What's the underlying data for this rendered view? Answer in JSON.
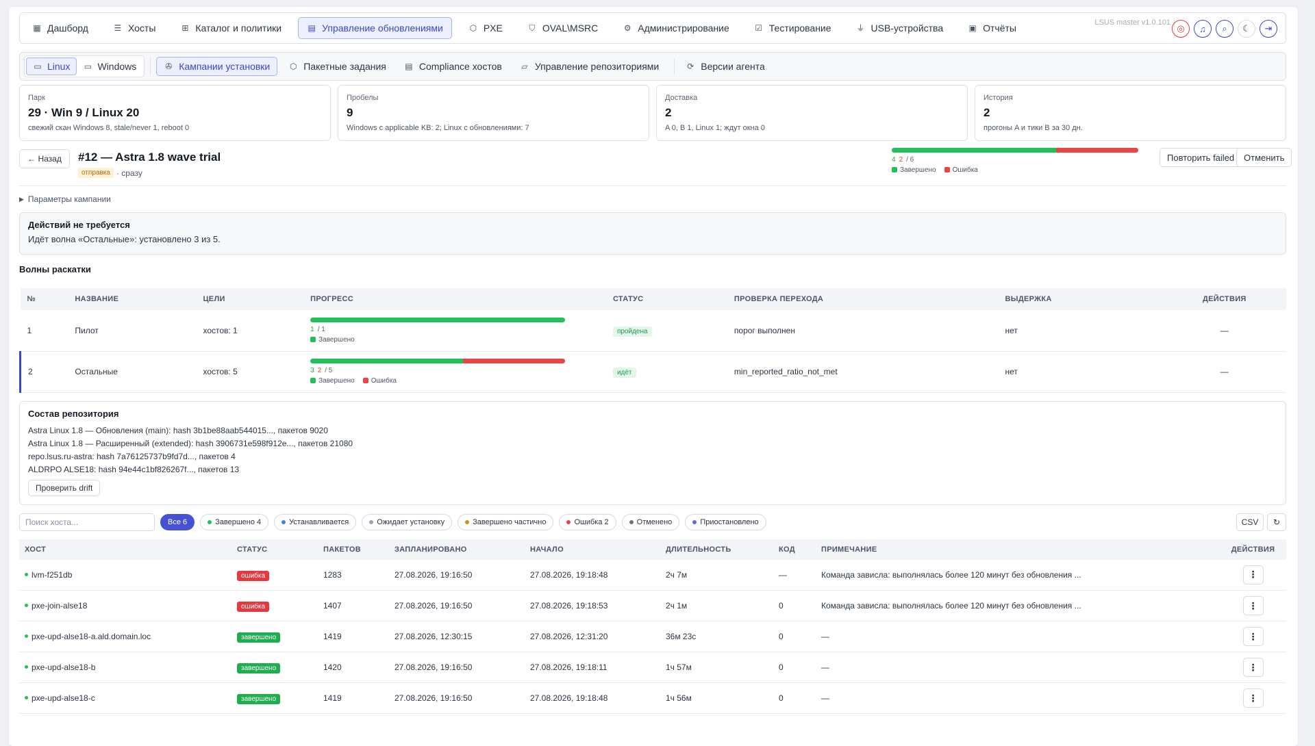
{
  "nav": {
    "items": [
      {
        "label": "Дашборд",
        "icon": "dashboard-icon",
        "glyph": "▦"
      },
      {
        "label": "Хосты",
        "icon": "server-icon",
        "glyph": "☰"
      },
      {
        "label": "Каталог и политики",
        "icon": "hierarchy-icon",
        "glyph": "⊞"
      },
      {
        "label": "Управление обновлениями",
        "icon": "download-file-icon",
        "glyph": "▤",
        "active": true
      },
      {
        "label": "PXE",
        "icon": "cube-icon",
        "glyph": "⬡"
      },
      {
        "label": "OVAL\\MSRC",
        "icon": "shield-check-icon",
        "glyph": "⛉"
      },
      {
        "label": "Администрирование",
        "icon": "user-gear-icon",
        "glyph": "⚙"
      },
      {
        "label": "Тестирование",
        "icon": "checklist-icon",
        "glyph": "☑"
      },
      {
        "label": "USB-устройства",
        "icon": "usb-icon",
        "glyph": "⏚"
      },
      {
        "label": "Отчёты",
        "icon": "report-icon",
        "glyph": "▣"
      }
    ],
    "version": "LSUS master v1.0.101",
    "icons": [
      "lifebuoy-icon",
      "bell-icon",
      "search-zoom-icon",
      "moon-icon",
      "logout-icon"
    ]
  },
  "subnav": {
    "os": [
      {
        "label": "Linux",
        "icon": "terminal-icon",
        "glyph": "▭",
        "active": true
      },
      {
        "label": "Windows",
        "icon": "monitor-icon",
        "glyph": "▭"
      }
    ],
    "items": [
      {
        "label": "Кампании установки",
        "icon": "megaphone-icon",
        "glyph": "✇",
        "active": true
      },
      {
        "label": "Пакетные задания",
        "icon": "package-icon",
        "glyph": "⬡"
      },
      {
        "label": "Compliance хостов",
        "icon": "list-check-icon",
        "glyph": "▤"
      },
      {
        "label": "Управление репозиториями",
        "icon": "folder-icon",
        "glyph": "▱"
      }
    ],
    "agent": {
      "label": "Версии агента",
      "icon": "gear-refresh-icon",
      "glyph": "⟳"
    }
  },
  "cards": [
    {
      "label": "Парк",
      "value": "29 · Win 9 / Linux 20",
      "sub": "свежий скан Windows 8, stale/never 1, reboot 0"
    },
    {
      "label": "Пробелы",
      "value": "9",
      "sub": "Windows с applicable KB: 2; Linux с обновлениями: 7"
    },
    {
      "label": "Доставка",
      "value": "2",
      "sub": "A 0, B 1, Linux 1; ждут окна 0"
    },
    {
      "label": "История",
      "value": "2",
      "sub": "прогоны A и тики B за 30 дн."
    }
  ],
  "campaign": {
    "back": "← Назад",
    "title": "#12 — Astra 1.8 wave trial",
    "badge": "отправка",
    "timing": "· сразу",
    "progress": {
      "done": 4,
      "failed": 2,
      "total": 6,
      "done_text": "4",
      "failed_text": "2",
      "total_text": "/ 6"
    },
    "legend_done": "Завершено",
    "legend_error": "Ошибка",
    "retry": "Повторить failed",
    "cancel": "Отменить",
    "params": "Параметры кампании"
  },
  "alert": {
    "title": "Действий не требуется",
    "desc": "Идёт волна «Остальные»: установлено 3 из 5."
  },
  "waves": {
    "title": "Волны раскатки",
    "headers": [
      "№",
      "НАЗВАНИЕ",
      "ЦЕЛИ",
      "ПРОГРЕСС",
      "СТАТУС",
      "ПРОВЕРКА ПЕРЕХОДА",
      "ВЫДЕРЖКА",
      "ДЕЙСТВИЯ"
    ],
    "rows": [
      {
        "n": "1",
        "name": "Пилот",
        "targets": "хостов: 1",
        "done": 1,
        "failed": 0,
        "total": 1,
        "done_text": "1",
        "failed_text": "",
        "total_text": "/ 1",
        "status": "пройдена",
        "check": "порог выполнен",
        "hold": "нет",
        "actions": "—",
        "current": false,
        "legend": [
          "Завершено"
        ]
      },
      {
        "n": "2",
        "name": "Остальные",
        "targets": "хостов: 5",
        "done": 3,
        "failed": 2,
        "total": 5,
        "done_text": "3",
        "failed_text": "2",
        "total_text": "/ 5",
        "status": "идёт",
        "check": "min_reported_ratio_not_met",
        "hold": "нет",
        "actions": "—",
        "current": true,
        "legend": [
          "Завершено",
          "Ошибка"
        ]
      }
    ]
  },
  "repo": {
    "title": "Состав репозитория",
    "lines": [
      "Astra Linux 1.8 — Обновления (main): hash 3b1be88aab544015..., пакетов 9020",
      "Astra Linux 1.8 — Расширенный (extended): hash 3906731e598f912e..., пакетов 21080",
      "repo.lsus.ru-astra: hash 7a76125737b9fd7d..., пакетов 4",
      "ALDRPO ALSE18: hash 94e44c1bf826267f..., пакетов 13"
    ],
    "drift": "Проверить drift"
  },
  "filters": {
    "search_placeholder": "Поиск хоста...",
    "chips": [
      {
        "label": "Все 6",
        "color": "",
        "active": true
      },
      {
        "label": "Завершено 4",
        "color": "#22c05b"
      },
      {
        "label": "Устанавливается",
        "color": "#3b82f6"
      },
      {
        "label": "Ожидает установку",
        "color": "#9aa3af"
      },
      {
        "label": "Завершено частично",
        "color": "#c59a12"
      },
      {
        "label": "Ошибка 2",
        "color": "#e84545"
      },
      {
        "label": "Отменено",
        "color": "#6b7280"
      },
      {
        "label": "Приостановлено",
        "color": "#6366f1"
      }
    ],
    "csv": "CSV",
    "refresh": "↻"
  },
  "hosts": {
    "headers": [
      "ХОСТ",
      "СТАТУС",
      "ПАКЕТОВ",
      "ЗАПЛАНИРОВАНО",
      "НАЧАЛО",
      "ДЛИТЕЛЬНОСТЬ",
      "КОД",
      "ПРИМЕЧАНИЕ",
      "ДЕЙСТВИЯ"
    ],
    "rows": [
      {
        "host": "lvm-f251db",
        "status": "ошибка",
        "kind": "err",
        "packages": "1283",
        "planned": "27.08.2026, 19:16:50",
        "start": "27.08.2026, 19:18:48",
        "duration": "2ч 7м",
        "code": "—",
        "note": "Команда зависла: выполнялась более 120 минут без обновления ...",
        "note_err": true
      },
      {
        "host": "pxe-join-alse18",
        "status": "ошибка",
        "kind": "err",
        "packages": "1407",
        "planned": "27.08.2026, 19:16:50",
        "start": "27.08.2026, 19:18:53",
        "duration": "2ч 1м",
        "code": "0",
        "note": "Команда зависла: выполнялась более 120 минут без обновления ...",
        "note_err": true
      },
      {
        "host": "pxe-upd-alse18-a.ald.domain.loc",
        "status": "завершено",
        "kind": "ok",
        "packages": "1419",
        "planned": "27.08.2026, 12:30:15",
        "start": "27.08.2026, 12:31:20",
        "duration": "36м 23с",
        "code": "0",
        "note": "—",
        "note_err": false
      },
      {
        "host": "pxe-upd-alse18-b",
        "status": "завершено",
        "kind": "ok",
        "packages": "1420",
        "planned": "27.08.2026, 19:16:50",
        "start": "27.08.2026, 19:18:11",
        "duration": "1ч 57м",
        "code": "0",
        "note": "—",
        "note_err": false
      },
      {
        "host": "pxe-upd-alse18-c",
        "status": "завершено",
        "kind": "ok",
        "packages": "1419",
        "planned": "27.08.2026, 19:16:50",
        "start": "27.08.2026, 19:18:48",
        "duration": "1ч 56м",
        "code": "0",
        "note": "—",
        "note_err": false
      }
    ]
  },
  "colors": {
    "accent": "#3b47c6",
    "success": "#22c05b",
    "error": "#e84545",
    "warning": "#b26b00"
  }
}
